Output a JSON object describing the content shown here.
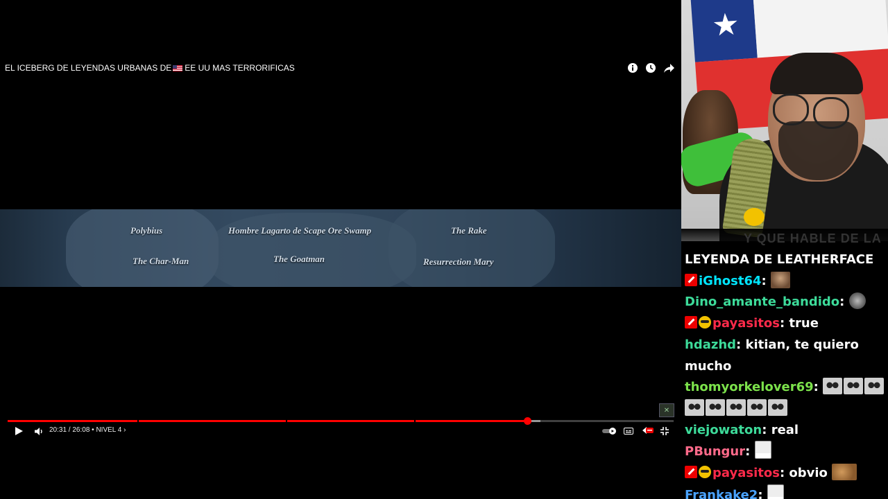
{
  "player": {
    "title_part1": "EL ICEBERG DE LEYENDAS URBANAS DE",
    "title_part2": "EE UU MAS TERRORIFICAS",
    "title_flag": "us-flag-icon",
    "top_icons": [
      "info-icon",
      "watch-later-icon",
      "share-icon"
    ],
    "iceberg_legends": [
      "Polybius",
      "Hombre Lagarto de Scape Ore Swamp",
      "The Rake",
      "The Char-Man",
      "The Goatman",
      "Resurrection Mary"
    ],
    "progress": {
      "fraction": 0.7799,
      "buffered_fraction": 0.8,
      "chapter_marks": [
        0.195,
        0.418,
        0.61
      ]
    },
    "time_readout": "20:31 / 26:08 • NIVEL 4 ›",
    "controls_left": [
      "play-icon",
      "volume-icon"
    ],
    "controls_right": [
      "autoplay-toggle-icon",
      "subtitles-icon",
      "live-badge-icon",
      "exit-fullscreen-icon"
    ],
    "accent_color": "#ff0000"
  },
  "chat": {
    "faded_header": "Y QUE HABLE DE LA",
    "header_line": "LEYENDA DE LEATHERFACE",
    "messages": [
      {
        "user": "iGhost64",
        "color": "#00e5ff",
        "badges": [
          "mod"
        ],
        "text": "",
        "emotes": [
          "face"
        ]
      },
      {
        "user": "Dino_amante_bandido",
        "color": "#3ddb9a",
        "badges": [],
        "text": "",
        "emotes": [
          "ball"
        ]
      },
      {
        "user": "payasitos",
        "color": "#ff2a4a",
        "badges": [
          "mod",
          "emoji"
        ],
        "text": "true",
        "emotes": []
      },
      {
        "user": "hdazhd",
        "color": "#3ddb9a",
        "badges": [],
        "text": "kitian, te quiero mucho",
        "emotes": []
      },
      {
        "user": "thomyorkelover69",
        "color": "#7ce24b",
        "badges": [],
        "text": "",
        "emotes": [
          "alien",
          "alien",
          "alien",
          "alien",
          "alien",
          "alien",
          "alien",
          "alien"
        ]
      },
      {
        "user": "viejowaton",
        "color": "#3ddb9a",
        "badges": [],
        "text": "real",
        "emotes": []
      },
      {
        "user": "PBungur",
        "color": "#ff6a8a",
        "badges": [],
        "text": "",
        "emotes": [
          "true"
        ]
      },
      {
        "user": "payasitos",
        "color": "#ff2a4a",
        "badges": [
          "mod",
          "emoji"
        ],
        "text": "obvio",
        "emotes": [
          "cat"
        ]
      },
      {
        "user": "Frankake2",
        "color": "#4aa3ff",
        "badges": [],
        "text": "",
        "emotes": [
          "true"
        ]
      }
    ]
  }
}
